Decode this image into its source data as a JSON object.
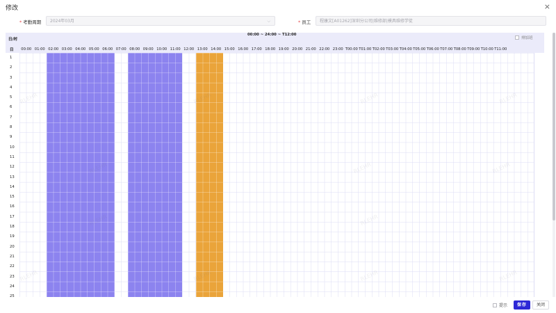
{
  "dialog": {
    "title": "修改",
    "close_glyph": "×"
  },
  "form": {
    "period_label": "考勤周期",
    "period_value": "2024年03月",
    "employee_label": "员工",
    "employee_value": "程康文[A01262]深圳分公司|维修部|模具维修学徒"
  },
  "schedule": {
    "corner_label_top": "日/时",
    "corner_label_day": "日",
    "time_range": "00:00 ~ 24:00 ~ T12:00",
    "extra_shift_label": "排加班",
    "hours": [
      "00:00",
      "01:00",
      "02:00",
      "03:00",
      "04:00",
      "05:00",
      "06:00",
      "07:00",
      "08:00",
      "09:00",
      "10:00",
      "11:00",
      "12:00",
      "13:00",
      "14:00",
      "15:00",
      "16:00",
      "17:00",
      "18:00",
      "19:00",
      "20:00",
      "21:00",
      "22:00",
      "23:00",
      "T00:00",
      "T01:00",
      "T02:00",
      "T03:00",
      "T04:00",
      "T05:00",
      "T06:00",
      "T07:00",
      "T08:00",
      "T09:00",
      "T10:00",
      "T11:00"
    ],
    "days": [
      "1",
      "2",
      "3",
      "4",
      "5",
      "6",
      "7",
      "8",
      "9",
      "10",
      "11",
      "12",
      "13",
      "14",
      "15",
      "16",
      "17",
      "18",
      "19",
      "20",
      "21",
      "22",
      "23",
      "24",
      "25"
    ],
    "shift_colors": {
      "work": "#8c83ef",
      "break": "#eaa43a"
    },
    "watermark": "RLEHR"
  },
  "footer": {
    "hint_label": "提示",
    "save_label": "保存",
    "close_label": "关闭"
  },
  "colors": {
    "primary": "#2d28d6",
    "grid_line": "#dcdcf4",
    "header_bg": "#ebebfa"
  }
}
